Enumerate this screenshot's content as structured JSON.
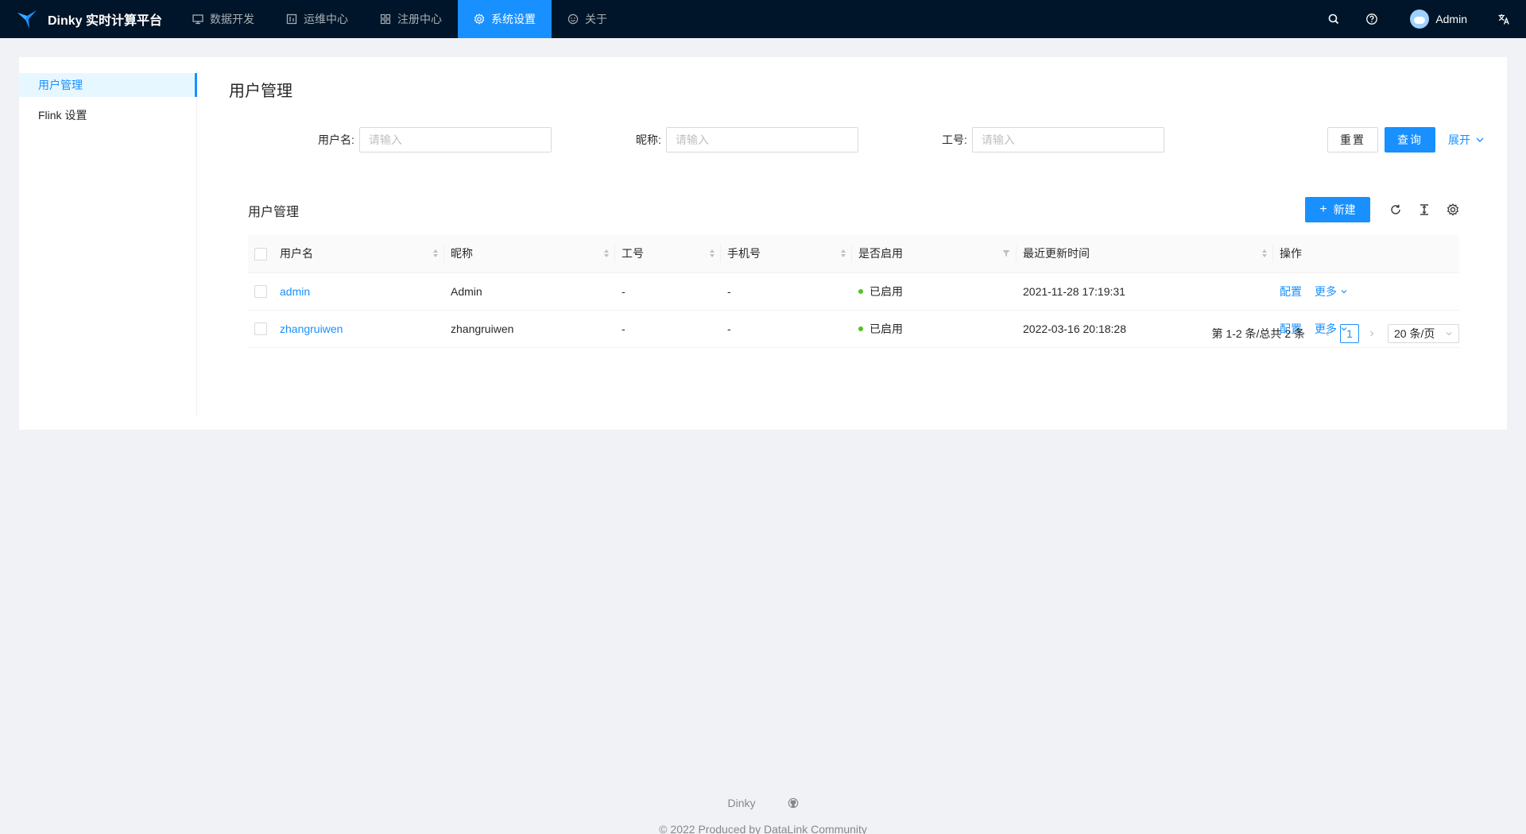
{
  "app": {
    "title": "Dinky 实时计算平台"
  },
  "nav": {
    "items": [
      {
        "label": "数据开发",
        "icon": "desktop-icon"
      },
      {
        "label": "运维中心",
        "icon": "monitor-icon"
      },
      {
        "label": "注册中心",
        "icon": "appstore-icon"
      },
      {
        "label": "系统设置",
        "icon": "setting-icon",
        "active": true
      },
      {
        "label": "关于",
        "icon": "smile-icon"
      }
    ],
    "user": "Admin"
  },
  "sidebar": {
    "items": [
      {
        "label": "用户管理",
        "active": true
      },
      {
        "label": "Flink 设置"
      }
    ]
  },
  "page": {
    "title": "用户管理"
  },
  "search": {
    "fields": [
      {
        "label": "用户名:",
        "placeholder": "请输入",
        "value": ""
      },
      {
        "label": "昵称:",
        "placeholder": "请输入",
        "value": ""
      },
      {
        "label": "工号:",
        "placeholder": "请输入",
        "value": ""
      }
    ],
    "reset_label": "重置",
    "query_label": "查询",
    "expand_label": "展开"
  },
  "table": {
    "title": "用户管理",
    "new_label": "新建",
    "columns": [
      "用户名",
      "昵称",
      "工号",
      "手机号",
      "是否启用",
      "最近更新时间",
      "操作"
    ],
    "rows": [
      {
        "username": "admin",
        "nickname": "Admin",
        "worknum": "-",
        "mobile": "-",
        "enabled": "已启用",
        "updated": "2021-11-28 17:19:31",
        "op_config": "配置",
        "op_more": "更多"
      },
      {
        "username": "zhangruiwen",
        "nickname": "zhangruiwen",
        "worknum": "-",
        "mobile": "-",
        "enabled": "已启用",
        "updated": "2022-03-16 20:18:28",
        "op_config": "配置",
        "op_more": "更多"
      }
    ]
  },
  "pagination": {
    "total_text": "第 1-2 条/总共 2 条",
    "current": "1",
    "page_size": "20 条/页"
  },
  "footer": {
    "link": "Dinky",
    "copyright": "2022 Produced by DataLink Community"
  },
  "colors": {
    "primary": "#1890ff",
    "header_bg": "#001529",
    "success": "#52c41a"
  }
}
